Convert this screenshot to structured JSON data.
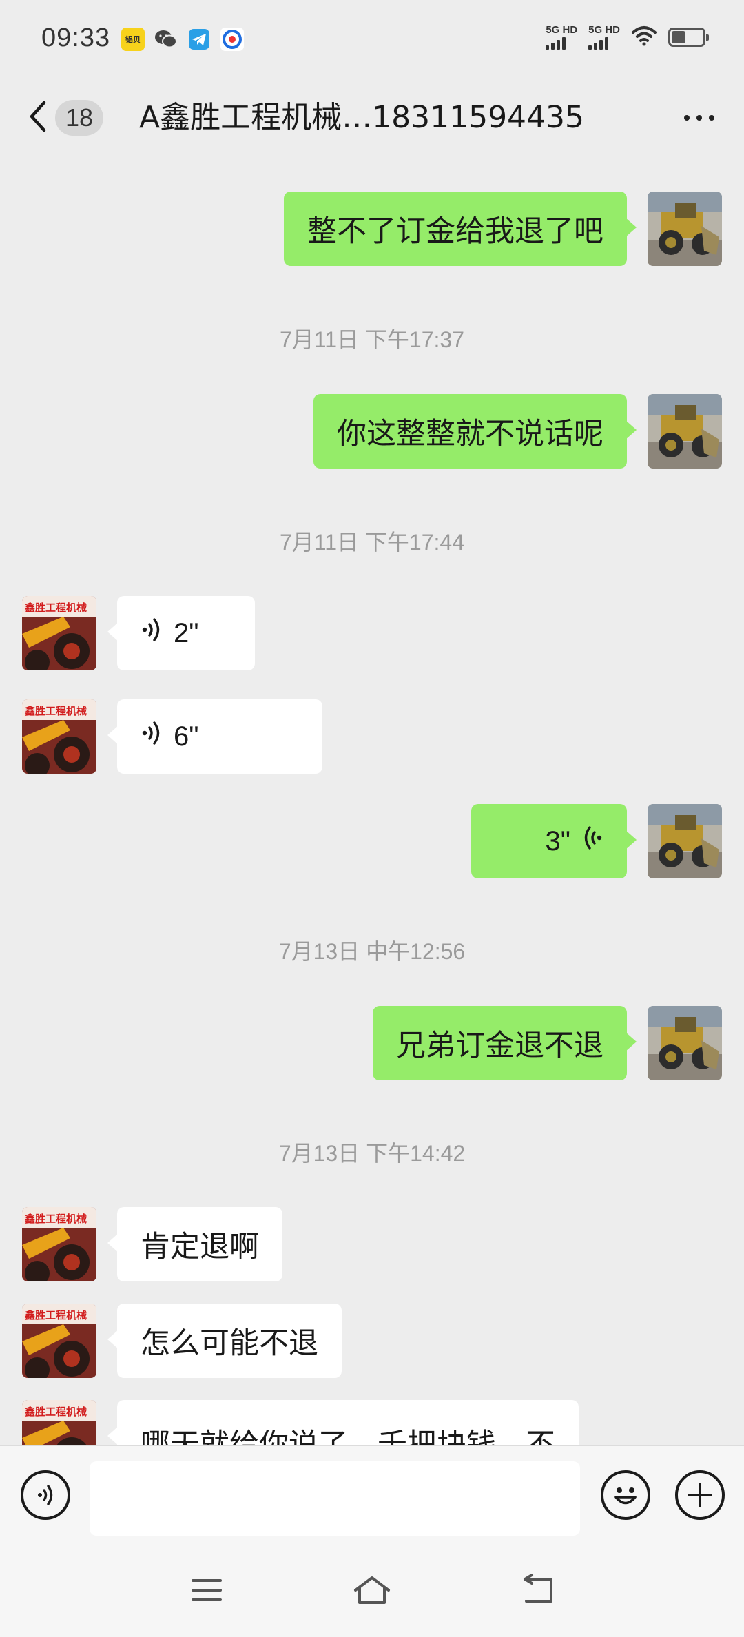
{
  "status_bar": {
    "time": "09:33",
    "signal_1_label": "5G HD",
    "signal_2_label": "5G HD",
    "battery_level": 0.45,
    "notification_icons": [
      "app-notification-icon",
      "wechat-icon",
      "telegram-icon",
      "browser-icon"
    ],
    "app_icon_text": "铝贝"
  },
  "header": {
    "back_icon": "chevron-left-icon",
    "unread_count": "18",
    "title": "A鑫胜工程机械…18311594435",
    "more_icon": "more-dots-icon"
  },
  "messages": [
    {
      "type": "text",
      "sender": "self",
      "text": "整不了订金给我退了吧"
    },
    {
      "type": "timestamp",
      "text": "7月11日 下午17:37"
    },
    {
      "type": "text",
      "sender": "self",
      "text": "你这整整就不说话呢"
    },
    {
      "type": "timestamp",
      "text": "7月11日 下午17:44"
    },
    {
      "type": "voice",
      "sender": "other",
      "duration": "2\""
    },
    {
      "type": "voice",
      "sender": "other",
      "duration": "6\""
    },
    {
      "type": "voice",
      "sender": "self",
      "duration": "3\""
    },
    {
      "type": "timestamp",
      "text": "7月13日 中午12:56"
    },
    {
      "type": "text",
      "sender": "self",
      "text": "兄弟订金退不退"
    },
    {
      "type": "timestamp",
      "text": "7月13日 下午14:42"
    },
    {
      "type": "text",
      "sender": "other",
      "text": "肯定退啊"
    },
    {
      "type": "text",
      "sender": "other",
      "text": "怎么可能不退"
    },
    {
      "type": "text",
      "sender": "other",
      "text": "哪天就给你说了，千把块钱，不"
    }
  ],
  "contact_avatar_text": "鑫胜工程机械",
  "input_bar": {
    "voice_icon": "voice-mode-icon",
    "input_value": "",
    "emoji_icon": "emoji-icon",
    "plus_icon": "plus-icon"
  },
  "nav_bar": {
    "menu_icon": "menu-icon",
    "home_icon": "home-icon",
    "back_icon": "back-icon"
  },
  "colors": {
    "background": "#ededed",
    "self_bubble": "#95ec69",
    "other_bubble": "#ffffff",
    "timestamp": "#9a9a9a"
  }
}
